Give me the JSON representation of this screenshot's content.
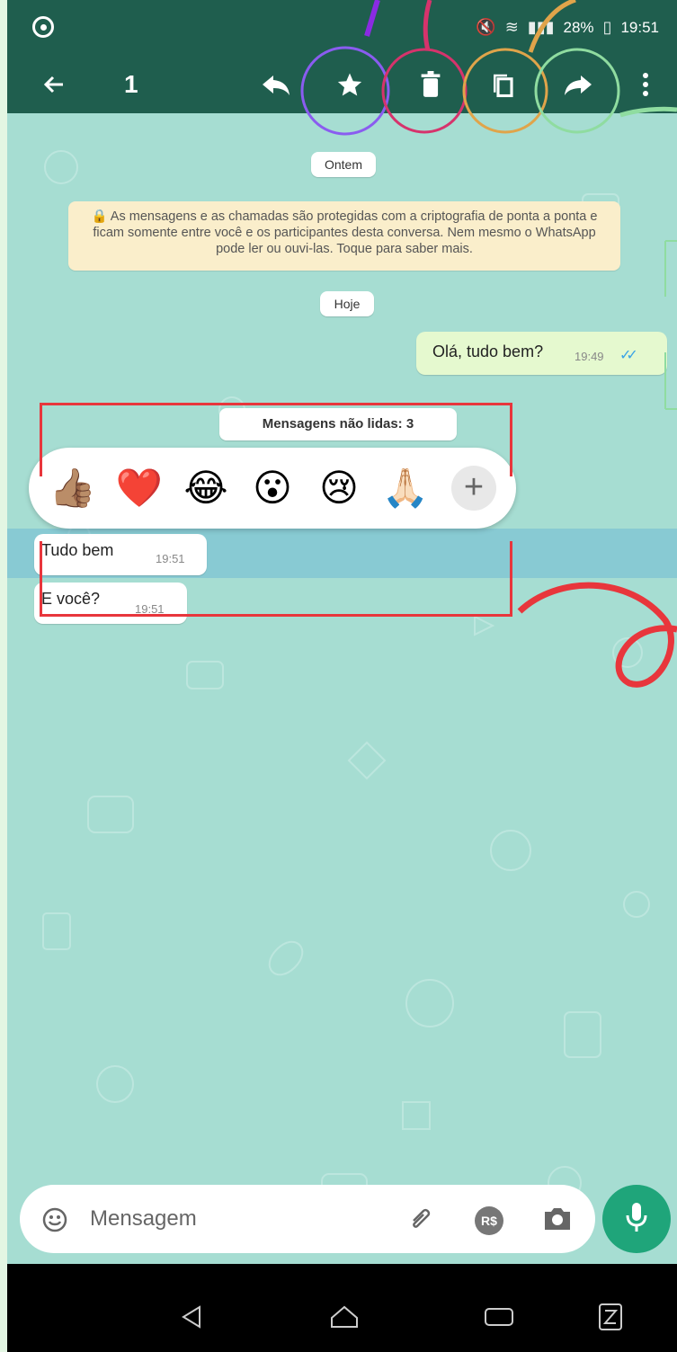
{
  "status_bar": {
    "battery": "28%",
    "time": "19:51",
    "signal_icons": [
      "mute-icon",
      "wifi-icon",
      "signal-icon",
      "battery-icon"
    ]
  },
  "toolbar": {
    "selected_count": "1",
    "actions": [
      "back-icon",
      "reply-icon",
      "star-icon",
      "delete-icon",
      "copy-icon",
      "forward-icon",
      "more-icon"
    ]
  },
  "chat": {
    "date_yesterday": "Ontem",
    "encryption_notice": "🔒 As mensagens e as chamadas são protegidas com a criptografia de ponta a ponta e ficam somente entre você e os participantes desta conversa. Nem mesmo o WhatsApp pode ler ou ouvi-las. Toque para saber mais.",
    "date_today": "Hoje",
    "outgoing": {
      "text": "Olá, tudo bem?",
      "time": "19:49"
    },
    "unread_label": "Mensagens não lidas: 3",
    "incoming": [
      {
        "text": "Tudo bem",
        "time": "19:51"
      },
      {
        "text": "E você?",
        "time": "19:51"
      }
    ],
    "reactions": [
      "👍🏽",
      "❤️",
      "😂",
      "😮",
      "😢",
      "🙏🏻"
    ]
  },
  "composer": {
    "placeholder": "Mensagem",
    "currency_label": "R$"
  },
  "colors": {
    "header": "#1f5e4e",
    "chat_bg": "#a6ddd2",
    "accent": "#1fa57a",
    "annotation_red": "#e8363c"
  }
}
